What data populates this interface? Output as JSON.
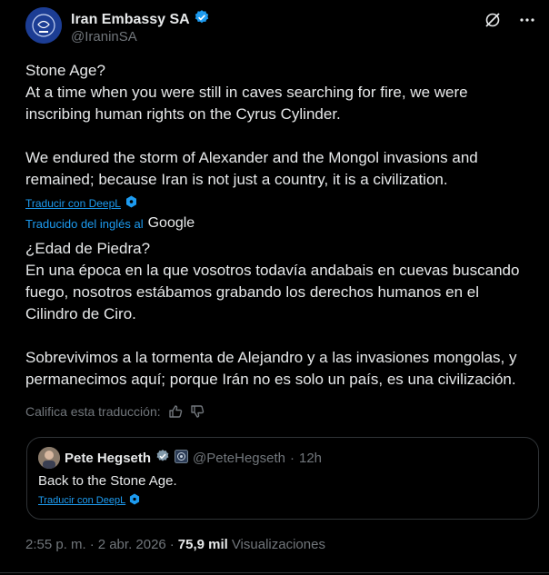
{
  "author": {
    "display_name": "Iran Embassy SA",
    "handle": "@IraninSA"
  },
  "tweet": {
    "text": "Stone Age?\nAt a time when you were still in caves searching for fire, we were inscribing human rights on the Cyrus Cylinder.\n\nWe endured the storm of Alexander and the Mongol invasions and remained; because Iran is not just a country, it is a civilization.",
    "translate_link": "Traducir con DeepL",
    "translated_by_prefix": "Traducido del inglés al",
    "translated_by_brand": "Google",
    "translated_text": "¿Edad de Piedra?\nEn una época en la que vosotros todavía andabais en cuevas buscando fuego, nosotros estábamos grabando los derechos humanos en el Cilindro de Ciro.\n\nSobrevivimos a la tormenta de Alejandro y a las invasiones mongolas, y permanecimos aquí; porque Irán no es solo un país, es una civilización.",
    "rate_label": "Califica esta traducción:"
  },
  "quote": {
    "display_name": "Pete Hegseth",
    "handle": "@PeteHegseth",
    "separator": "·",
    "time": "12h",
    "text": "Back to the Stone Age.",
    "translate_link": "Traducir con DeepL"
  },
  "meta": {
    "time": "2:55 p. m.",
    "separator1": "·",
    "date": "2 abr. 2026",
    "separator2": "·",
    "views_count": "75,9 mil",
    "views_label": "Visualizaciones"
  },
  "colors": {
    "background": "#000000",
    "text": "#e7e9ea",
    "muted": "#71767b",
    "link": "#1d9bf0",
    "border": "#2f3336"
  }
}
